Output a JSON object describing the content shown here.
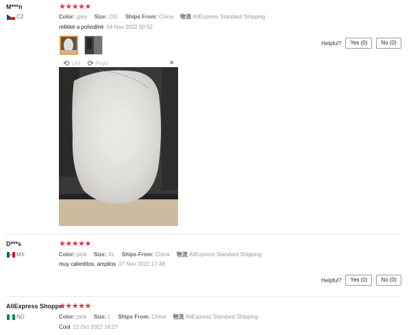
{
  "reviews": [
    {
      "user": "M***n",
      "country": "CZ",
      "stars": "★★★★★",
      "color_label": "Color:",
      "color": "grey",
      "size_label": "Size:",
      "size": "2XL",
      "ships_label": "Ships From:",
      "ships": "China",
      "logistics_label": "物流",
      "logistics": "AliExpress Standard Shipping",
      "text": "měkké a pohodlné",
      "date": "04 Nov 2022 00:52",
      "helpful_label": "Helpful?",
      "yes": "Yes (0)",
      "no": "No (0)"
    },
    {
      "user": "D***s",
      "country": "MX",
      "stars": "★★★★★",
      "color_label": "Color:",
      "color": "pink",
      "size_label": "Size:",
      "size": "XL",
      "ships_label": "Ships From:",
      "ships": "China",
      "logistics_label": "物流",
      "logistics": "AliExpress Standard Shipping",
      "text": "muy calentitos, amplios",
      "date": "07 Nov 2022 17:46",
      "helpful_label": "Helpful?",
      "yes": "Yes (0)",
      "no": "No (0)"
    },
    {
      "user": "AliExpress Shopper",
      "country": "NG",
      "stars": "★★★★★",
      "color_label": "Color:",
      "color": "pink",
      "size_label": "Size:",
      "size": "L",
      "ships_label": "Ships From:",
      "ships": "China",
      "logistics_label": "物流",
      "logistics": "AliExpress Standard Shipping",
      "text": "Cool",
      "date": "22 Oct 2022 16:27"
    }
  ],
  "viewer": {
    "left_label": "Left",
    "right_label": "Right",
    "close_glyph": "×"
  },
  "colors": {
    "star": "#e62e46",
    "thumb_selected_border": "#e8a040"
  }
}
